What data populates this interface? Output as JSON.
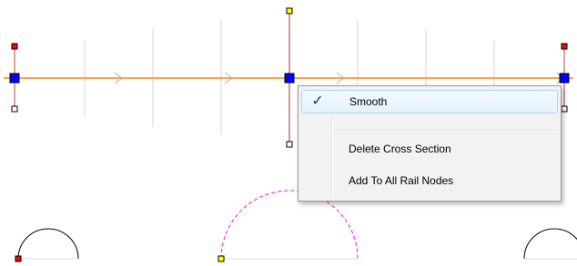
{
  "context_menu": {
    "items": [
      {
        "label": "Smooth",
        "checked": true
      },
      {
        "label": "Delete Cross Section",
        "checked": false
      },
      {
        "label": "Add To All Rail Nodes",
        "checked": false
      }
    ],
    "check_glyph": "✓"
  },
  "colors": {
    "rail": "#f4a84d",
    "node_selected": "#0000ff",
    "handle_top": "#ff0000",
    "handle_active": "#ffff00",
    "cross_section_active": "#ff00ff",
    "cross_section": "#000000",
    "grid": "#d0d0d0",
    "menu_highlight_border": "#a8d8f5"
  }
}
